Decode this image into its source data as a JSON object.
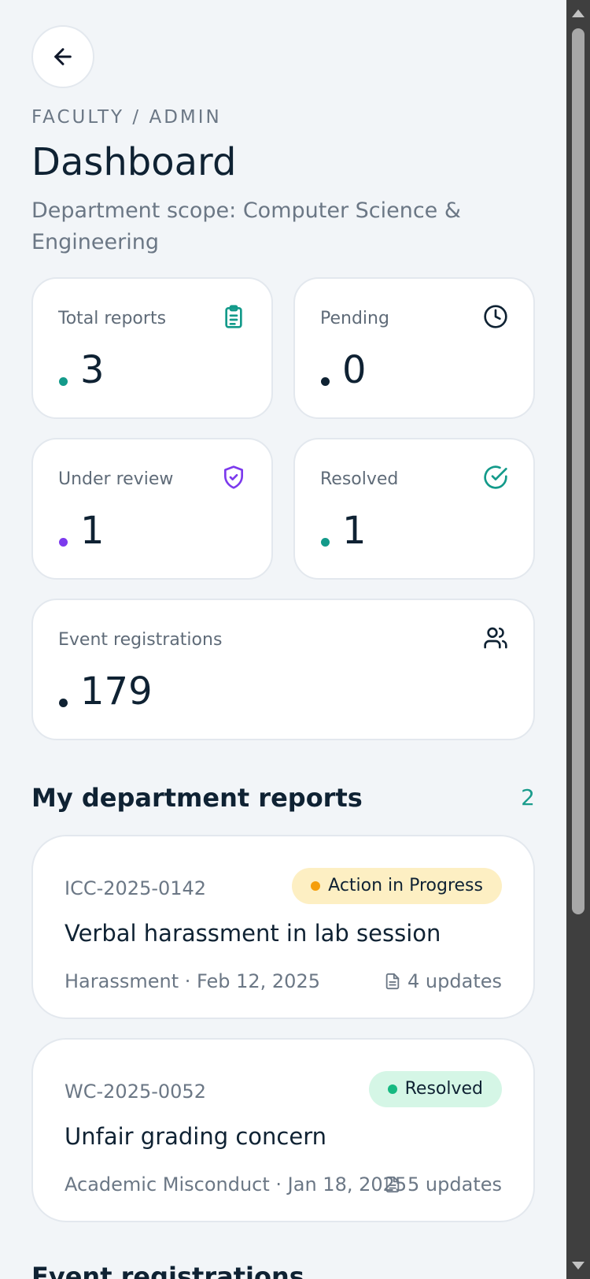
{
  "header": {
    "eyebrow": "FACULTY / ADMIN",
    "title": "Dashboard",
    "subtitle": "Department scope: Computer Science & Engineering"
  },
  "stats": [
    {
      "label": "Total reports",
      "value": "3",
      "icon": "clipboard-icon",
      "color": "#139a8a"
    },
    {
      "label": "Pending",
      "value": "0",
      "icon": "clock-icon",
      "color": "#0f2233"
    },
    {
      "label": "Under review",
      "value": "1",
      "icon": "shield-check-icon",
      "color": "#7c3aed"
    },
    {
      "label": "Resolved",
      "value": "1",
      "icon": "check-circle-icon",
      "color": "#139a8a"
    },
    {
      "label": "Event registrations",
      "value": "179",
      "icon": "users-icon",
      "color": "#0f2233"
    }
  ],
  "reports_section": {
    "title": "My department reports",
    "count": "2"
  },
  "reports": [
    {
      "id": "ICC-2025-0142",
      "status": "Action in Progress",
      "status_bg": "#fdefc3",
      "status_dot": "#f59e0b",
      "title": "Verbal harassment in lab session",
      "meta": "Harassment · Feb 12, 2025",
      "updates": "4 updates"
    },
    {
      "id": "WC-2025-0052",
      "status": "Resolved",
      "status_bg": "#d5f6e6",
      "status_dot": "#16b981",
      "title": "Unfair grading concern",
      "meta": "Academic Misconduct · Jan 18, 2025",
      "updates": "5 updates"
    }
  ],
  "next_section": {
    "title": "Event registrations"
  }
}
